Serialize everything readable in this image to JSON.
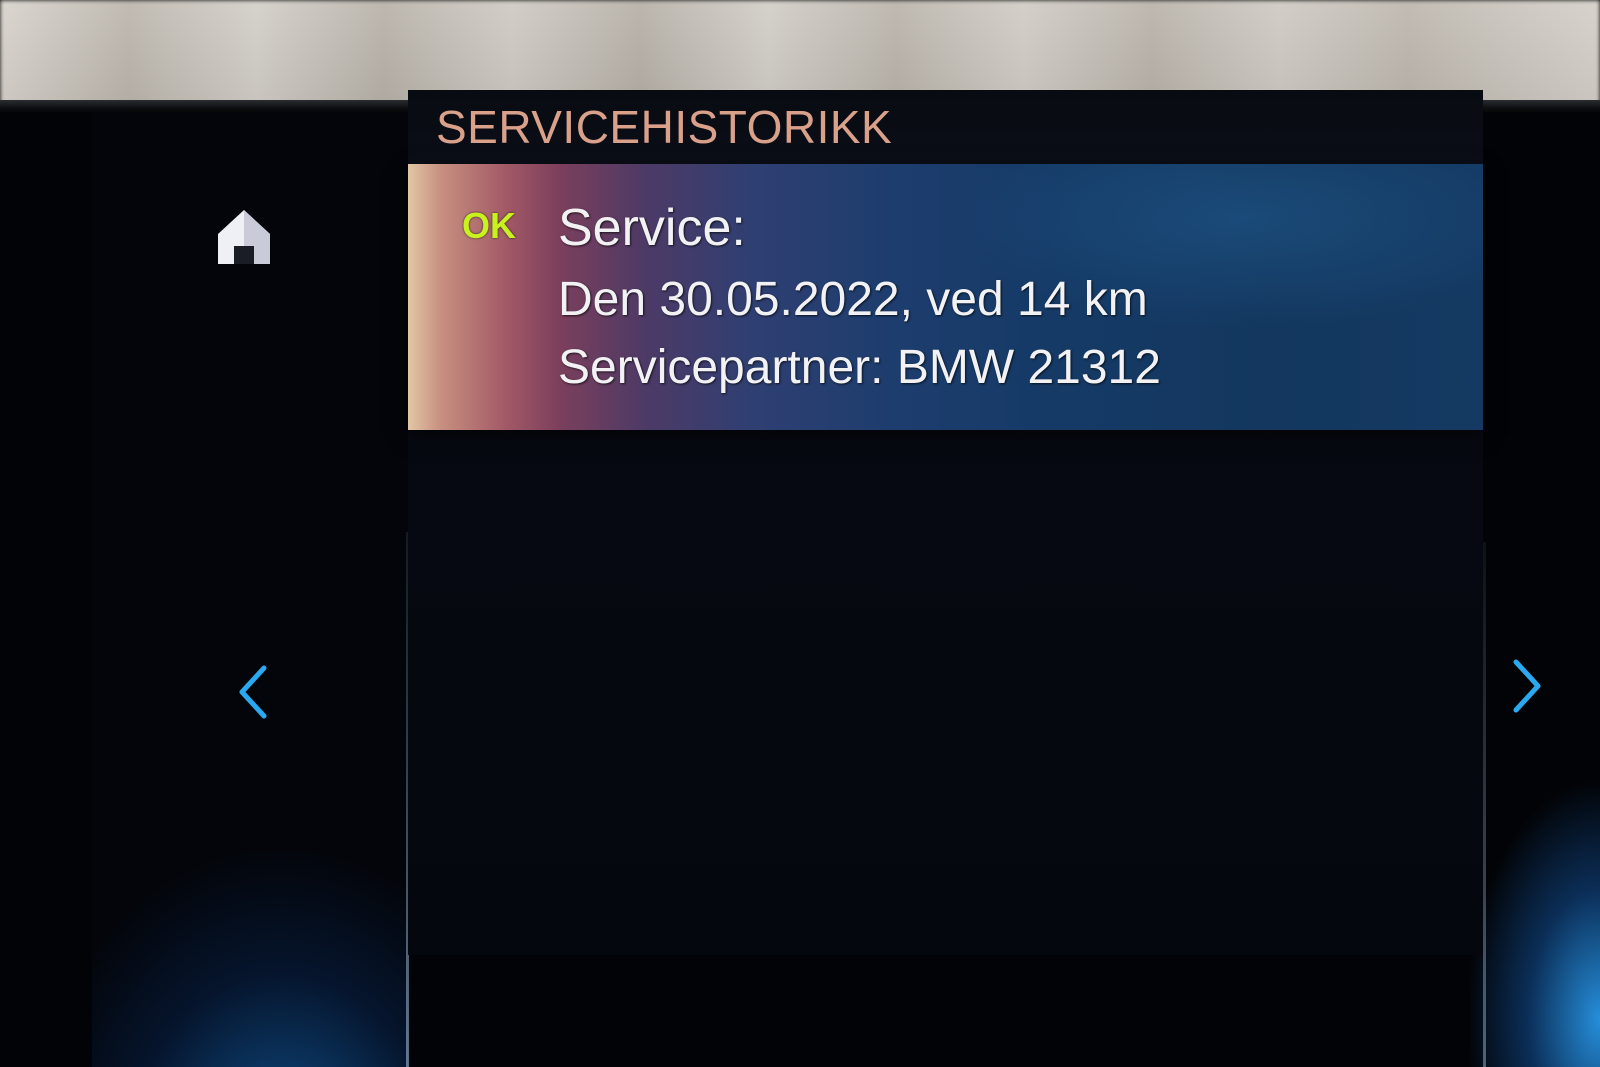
{
  "screen": {
    "title": "SERVICEHISTORIKK"
  },
  "service_entry": {
    "status": "OK",
    "heading": "Service:",
    "date_line": "Den 30.05.2022, ved 14 km",
    "partner_line": "Servicepartner: BMW 21312"
  },
  "navigation": {
    "home_icon": "home-icon",
    "prev_icon": "chevron-left-icon",
    "next_icon": "chevron-right-icon"
  },
  "colors": {
    "title": "#d9a08a",
    "status_ok": "#c8f21e",
    "accent_blue": "#2aa9f0",
    "card_text": "#f2f2f4"
  }
}
